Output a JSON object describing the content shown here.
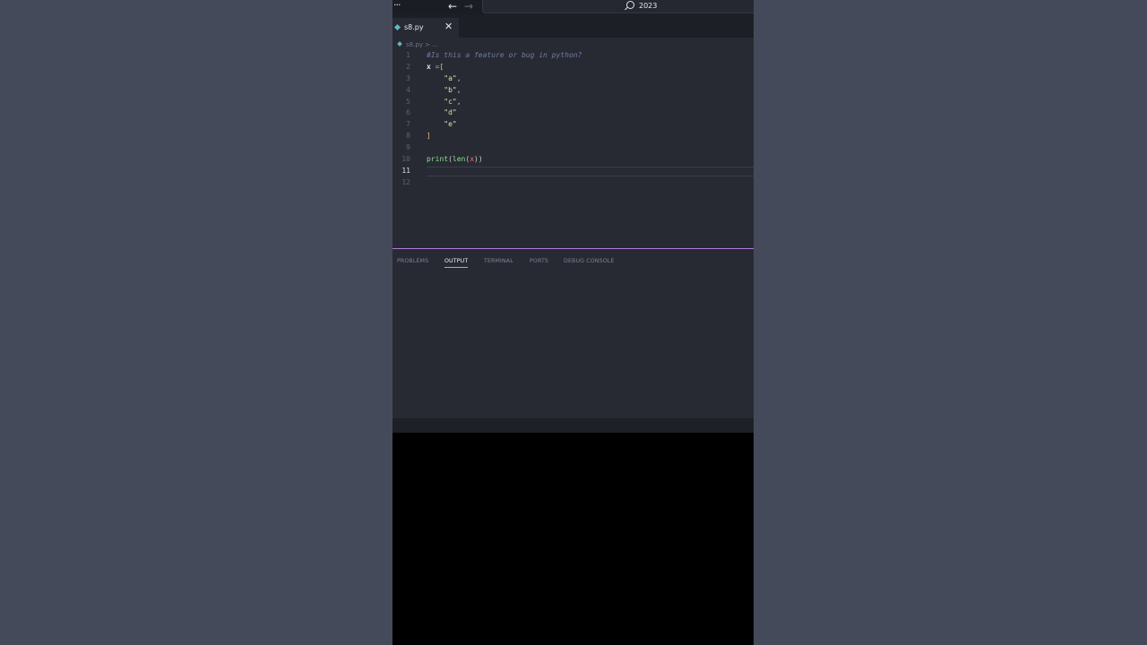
{
  "titlebar": {
    "menu": "···",
    "back": "←",
    "forward": "→",
    "search_text": "2023"
  },
  "tab": {
    "label": "s8.py",
    "close": "✕"
  },
  "breadcrumb": {
    "file": "s8.py",
    "sep": " > ..."
  },
  "editor": {
    "lines": [
      {
        "n": "1",
        "tokens": [
          {
            "t": "#Is this a feature or bug in python?",
            "c": "comment"
          }
        ]
      },
      {
        "n": "2",
        "tokens": [
          {
            "t": "x",
            "c": "var"
          },
          {
            "t": " =",
            "c": "op"
          },
          {
            "t": "[",
            "c": "bracket"
          }
        ]
      },
      {
        "n": "3",
        "tokens": [
          {
            "t": "    ",
            "c": "punc"
          },
          {
            "t": "\"a\"",
            "c": "str"
          },
          {
            "t": ",",
            "c": "punc"
          }
        ]
      },
      {
        "n": "4",
        "tokens": [
          {
            "t": "    ",
            "c": "punc"
          },
          {
            "t": "\"b\"",
            "c": "str"
          },
          {
            "t": ",",
            "c": "punc"
          }
        ]
      },
      {
        "n": "5",
        "tokens": [
          {
            "t": "    ",
            "c": "punc"
          },
          {
            "t": "\"c\"",
            "c": "str"
          },
          {
            "t": ",",
            "c": "punc"
          }
        ]
      },
      {
        "n": "6",
        "tokens": [
          {
            "t": "    ",
            "c": "punc"
          },
          {
            "t": "\"d\"",
            "c": "str"
          }
        ]
      },
      {
        "n": "7",
        "tokens": [
          {
            "t": "    ",
            "c": "punc"
          },
          {
            "t": "\"e\"",
            "c": "str"
          }
        ]
      },
      {
        "n": "8",
        "tokens": [
          {
            "t": "]",
            "c": "bracket"
          }
        ]
      },
      {
        "n": "9",
        "tokens": []
      },
      {
        "n": "10",
        "tokens": [
          {
            "t": "print",
            "c": "fn"
          },
          {
            "t": "(",
            "c": "punc"
          },
          {
            "t": "len",
            "c": "fn"
          },
          {
            "t": "(",
            "c": "punc"
          },
          {
            "t": "x",
            "c": "arg"
          },
          {
            "t": "))",
            "c": "punc"
          }
        ]
      },
      {
        "n": "11",
        "tokens": [],
        "current": true
      },
      {
        "n": "12",
        "tokens": []
      }
    ]
  },
  "panel": {
    "tabs": [
      {
        "label": "PROBLEMS",
        "active": false
      },
      {
        "label": "OUTPUT",
        "active": true
      },
      {
        "label": "TERMINAL",
        "active": false
      },
      {
        "label": "PORTS",
        "active": false
      },
      {
        "label": "DEBUG CONSOLE",
        "active": false
      }
    ]
  },
  "colors": {
    "accent": "#d88ae6",
    "editor_bg": "#272a33",
    "page_bg": "#454a5a"
  }
}
